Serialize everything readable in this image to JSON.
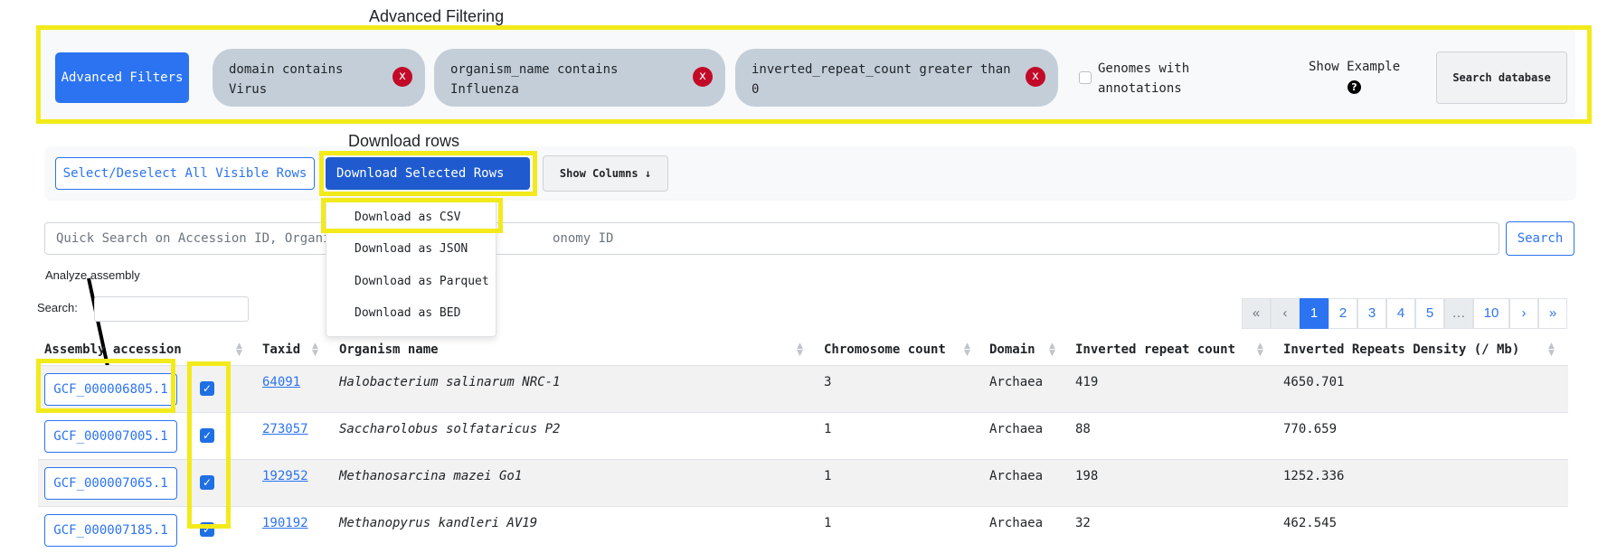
{
  "annotations": {
    "advanced_filtering": "Advanced Filtering",
    "download_rows": "Download rows",
    "analyze_assembly": "Analyze assembly"
  },
  "filters": {
    "advanced_button": "Advanced Filters",
    "chips": [
      {
        "line1": "domain contains",
        "line2": "Virus",
        "remove": "x"
      },
      {
        "line1": "organism_name contains",
        "line2": "Influenza",
        "remove": "x"
      },
      {
        "line1": "inverted_repeat_count greater than",
        "line2": "0",
        "remove": "x"
      }
    ],
    "annotations_checkbox_label": "Genomes with annotations",
    "annotations_checked": false,
    "show_example": "Show Example",
    "help_icon": "?",
    "search_button": "Search database"
  },
  "toolbar": {
    "select_all": "Select/Deselect All Visible Rows",
    "download_selected": "Download Selected Rows",
    "show_columns": "Show Columns ↓"
  },
  "download_menu": [
    "Download as CSV",
    "Download as JSON",
    "Download as Parquet",
    "Download as BED"
  ],
  "quick_search": {
    "placeholder_left": "Quick Search on Accession ID, Organi",
    "placeholder_right": "onomy ID",
    "button": "Search"
  },
  "table_search_label": "Search:",
  "pagination": [
    "«",
    "‹",
    "1",
    "2",
    "3",
    "4",
    "5",
    "…",
    "10",
    "›",
    "»"
  ],
  "pagination_active": "1",
  "columns": [
    "Assembly accession",
    "Taxid",
    "Organism name",
    "Chromosome count",
    "Domain",
    "Inverted repeat count",
    "Inverted Repeats Density (/ Mb)"
  ],
  "rows": [
    {
      "accession": "GCF_000006805.1",
      "taxid": "64091",
      "organism": "Halobacterium salinarum NRC-1",
      "chromosomes": "3",
      "domain": "Archaea",
      "ir_count": "419",
      "density": "4650.701",
      "selected": true
    },
    {
      "accession": "GCF_000007005.1",
      "taxid": "273057",
      "organism": "Saccharolobus solfataricus P2",
      "chromosomes": "1",
      "domain": "Archaea",
      "ir_count": "88",
      "density": "770.659",
      "selected": true
    },
    {
      "accession": "GCF_000007065.1",
      "taxid": "192952",
      "organism": "Methanosarcina mazei Go1",
      "chromosomes": "1",
      "domain": "Archaea",
      "ir_count": "198",
      "density": "1252.336",
      "selected": true
    },
    {
      "accession": "GCF_000007185.1",
      "taxid": "190192",
      "organism": "Methanopyrus kandleri AV19",
      "chromosomes": "1",
      "domain": "Archaea",
      "ir_count": "32",
      "density": "462.545",
      "selected": true
    }
  ],
  "colors": {
    "highlight": "#f2ea1a",
    "primary": "#2b73f1",
    "remove_chip": "#c20a28"
  }
}
